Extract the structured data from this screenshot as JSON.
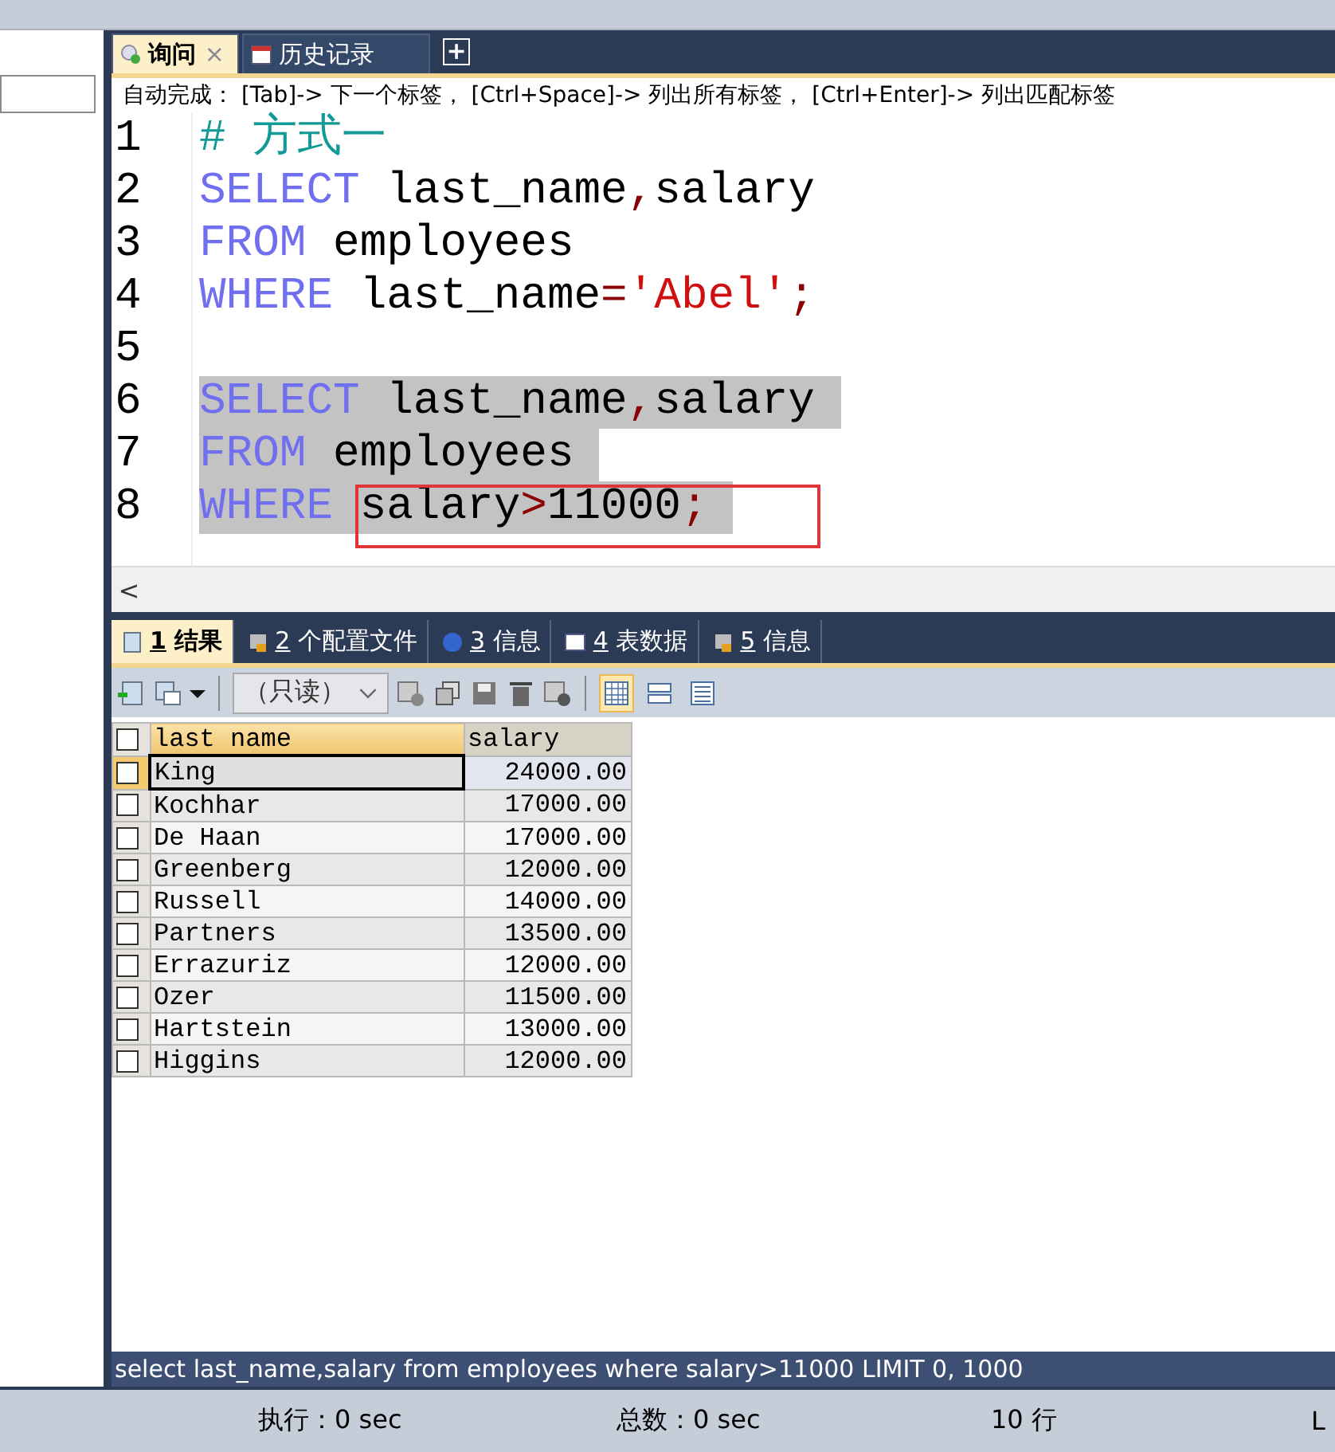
{
  "editor_tabs": [
    {
      "label": "询问",
      "selected": true,
      "close": "×"
    },
    {
      "label": "历史记录",
      "selected": false
    }
  ],
  "new_tab": "+",
  "autocomplete_hint": "自动完成： [Tab]-> 下一个标签， [Ctrl+Space]-> 列出所有标签， [Ctrl+Enter]-> 列出匹配标签",
  "code": {
    "lines": [
      {
        "number": "1",
        "selected": false,
        "tokens": [
          {
            "kind": "comment",
            "text": "# 方式一"
          }
        ]
      },
      {
        "number": "2",
        "selected": false,
        "tokens": [
          {
            "kind": "keyword",
            "text": "SELECT"
          },
          {
            "kind": "plain",
            "text": " last_name"
          },
          {
            "kind": "punct",
            "text": ","
          },
          {
            "kind": "plain",
            "text": "salary"
          }
        ]
      },
      {
        "number": "3",
        "selected": false,
        "tokens": [
          {
            "kind": "keyword",
            "text": "FROM"
          },
          {
            "kind": "plain",
            "text": " employees"
          }
        ]
      },
      {
        "number": "4",
        "selected": false,
        "tokens": [
          {
            "kind": "keyword",
            "text": "WHERE"
          },
          {
            "kind": "plain",
            "text": " last_name"
          },
          {
            "kind": "punct",
            "text": "="
          },
          {
            "kind": "string",
            "text": "'Abel'"
          },
          {
            "kind": "punct",
            "text": ";"
          }
        ]
      },
      {
        "number": "5",
        "selected": false
      },
      {
        "number": "6",
        "selected": true,
        "tokens": [
          {
            "kind": "keyword",
            "text": "SELECT"
          },
          {
            "kind": "plain",
            "text": " last_name"
          },
          {
            "kind": "punct",
            "text": ","
          },
          {
            "kind": "plain",
            "text": "salary"
          }
        ]
      },
      {
        "number": "7",
        "selected": true,
        "tokens": [
          {
            "kind": "keyword",
            "text": "FROM"
          },
          {
            "kind": "plain",
            "text": " employees"
          }
        ]
      },
      {
        "number": "8",
        "selected": true,
        "tokens": [
          {
            "kind": "keyword",
            "text": "WHERE"
          },
          {
            "kind": "boxed",
            "tokens": [
              {
                "kind": "plain",
                "text": "salary"
              },
              {
                "kind": "punct",
                "text": ">"
              },
              {
                "kind": "plain",
                "text": "11000"
              },
              {
                "kind": "punct",
                "text": ";"
              }
            ]
          }
        ]
      }
    ]
  },
  "scroll_left": "<",
  "result_tabs": [
    {
      "number": "1",
      "label": "结果",
      "selected": true
    },
    {
      "number": "2",
      "label": "个配置文件",
      "selected": false
    },
    {
      "number": "3",
      "label": "信息",
      "selected": false
    },
    {
      "number": "4",
      "label": "表数据",
      "selected": false
    },
    {
      "number": "5",
      "label": "信息",
      "selected": false
    }
  ],
  "toolbar": {
    "mode_dropdown": "（只读）",
    "view_modes": [
      {
        "selected": true
      },
      {
        "selected": false
      },
      {
        "selected": false
      }
    ]
  },
  "table": {
    "all_checked": false,
    "columns": [
      "last name",
      "salary"
    ],
    "rows": [
      {
        "last_name": "King",
        "salary": "24000.00",
        "checked": false,
        "current": true
      },
      {
        "last_name": "Kochhar",
        "salary": "17000.00",
        "checked": false,
        "current": false
      },
      {
        "last_name": "De Haan",
        "salary": "17000.00",
        "checked": false,
        "current": false
      },
      {
        "last_name": "Greenberg",
        "salary": "12000.00",
        "checked": false,
        "current": false
      },
      {
        "last_name": "Russell",
        "salary": "14000.00",
        "checked": false,
        "current": false
      },
      {
        "last_name": "Partners",
        "salary": "13500.00",
        "checked": false,
        "current": false
      },
      {
        "last_name": "Errazuriz",
        "salary": "12000.00",
        "checked": false,
        "current": false
      },
      {
        "last_name": "Ozer",
        "salary": "11500.00",
        "checked": false,
        "current": false
      },
      {
        "last_name": "Hartstein",
        "salary": "13000.00",
        "checked": false,
        "current": false
      },
      {
        "last_name": "Higgins",
        "salary": "12000.00",
        "checked": false,
        "current": false
      }
    ]
  },
  "executed_query": "select last_name,salary from employees where salary>11000 LIMIT 0, 1000",
  "status_bar": [
    "执行：0 sec",
    "总数：0 sec",
    "10 行",
    "L"
  ]
}
